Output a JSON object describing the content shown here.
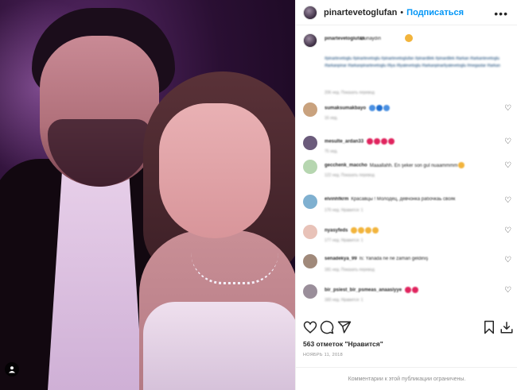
{
  "post": {
    "username": "pinartevetoglufan",
    "separator": "•",
    "follow_label": "Подписаться",
    "more_icon": "more-horizontal-icon"
  },
  "caption": {
    "username": "pinartevetoglufan",
    "text": "Gunaydın",
    "hashtags": "#pinartevetoglu #pinartevetoglu #pinartevetoglufan #pinardilek #pinardilek #tarkan #tarkantevetoglu #tarkanpinar #tarkanpinartevetoglu #liya #liyatevetoglu #tarkanpinarliyatevetoglu #megastar #tarkan",
    "meta": "206 нед.   Показать перевод"
  },
  "comments": [
    {
      "username": "sumaksumakbayo",
      "text": "",
      "meta": "16 нед.",
      "emoji": [
        "#4a90e2",
        "#1f6fd1",
        "#4a90e2"
      ],
      "avatar_color": "#c9a27e"
    },
    {
      "username": "mesulte_ardan33",
      "text": "",
      "meta": "75 нед.",
      "emoji": [
        "#e0245e",
        "#e0245e",
        "#e0245e",
        "#e0245e"
      ],
      "avatar_color": "#6b5b7b"
    },
    {
      "username": "gecchenk_maccho",
      "text": "Maaallahh. En şeker son gul nuaammmm",
      "meta": "122 нед.   Показать перевод",
      "emoji": [
        "#f2b43c"
      ],
      "avatar_color": "#b6d6b0"
    },
    {
      "username": "elvinhfkrm",
      "text": "Красавцы ! Молодец, девчонка рабочкаь свояк",
      "meta": "170 нед.   Нравится: 1",
      "emoji": [],
      "avatar_color": "#7fb0d0"
    },
    {
      "username": "nyasyfeds",
      "text": "",
      "meta": "177 нед.   Нравится: 1",
      "emoji": [
        "#f2b43c",
        "#f2b43c",
        "#f2b43c",
        "#f2b43c"
      ],
      "avatar_color": "#e8c2b8"
    },
    {
      "username": "senadekya_99",
      "text": "Is: Yanada ne ne zaman geldiniş",
      "meta": "181 нед.   Показать перевод",
      "emoji": [],
      "avatar_color": "#a0897a"
    },
    {
      "username": "bir_psiest_bir_psmeas_anaasiyye",
      "text": "",
      "meta": "183 нед.   Нравится: 1",
      "emoji": [
        "#e0245e",
        "#e0245e"
      ],
      "avatar_color": "#9a8e9a"
    }
  ],
  "actions": {
    "like_icon": "heart-icon",
    "comment_icon": "comment-icon",
    "share_icon": "share-icon",
    "save_icon": "bookmark-icon",
    "download_icon": "download-icon"
  },
  "likes_text": "563 отметок \"Нравится\"",
  "date_text": "НОЯБРЬ 11, 2018",
  "footer_text": "Комментарии к этой публикации ограничены."
}
